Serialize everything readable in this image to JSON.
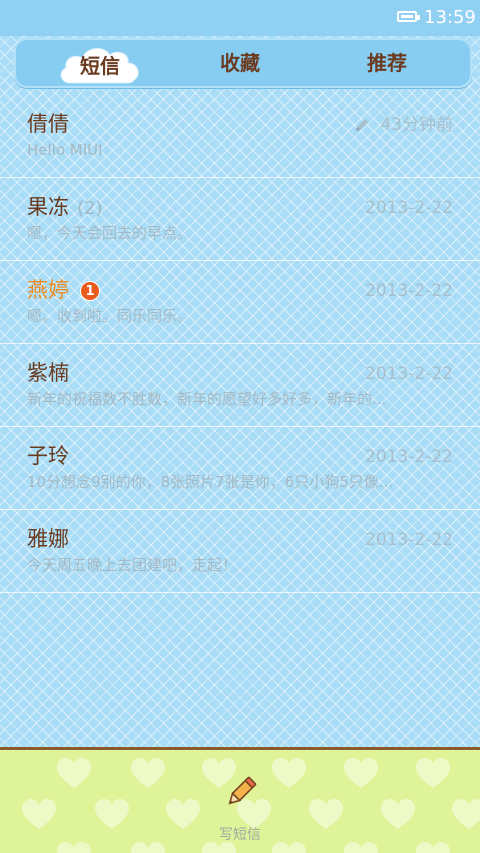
{
  "status_bar": {
    "time": "13:59",
    "battery_icon": "battery-full-icon"
  },
  "tabs": [
    {
      "label": "短信",
      "active": true
    },
    {
      "label": "收藏",
      "active": false
    },
    {
      "label": "推荐",
      "active": false
    }
  ],
  "conversations": [
    {
      "name": "倩倩",
      "count": "",
      "unread": "",
      "preview": "Hello MIUI",
      "time": "43分钟前",
      "draft": true
    },
    {
      "name": "果冻",
      "count": "(2)",
      "unread": "",
      "preview": "嗯，今天会回去的早点。",
      "time": "2013-2-22",
      "draft": false
    },
    {
      "name": "燕婷",
      "count": "",
      "unread": "1",
      "preview": "嗯。收到啦。同乐同乐。",
      "time": "2013-2-22",
      "draft": false
    },
    {
      "name": "紫楠",
      "count": "",
      "unread": "",
      "preview": "新年的祝福数不胜数，新年的愿望好多好多，新年的...",
      "time": "2013-2-22",
      "draft": false
    },
    {
      "name": "子玲",
      "count": "",
      "unread": "",
      "preview": "10分想念9别的你，8张照片7张是你，6只小狗5只像...",
      "time": "2013-2-22",
      "draft": false
    },
    {
      "name": "雅娜",
      "count": "",
      "unread": "",
      "preview": "今天周五晚上去团建吧，走起！",
      "time": "2013-2-22",
      "draft": false
    }
  ],
  "bottom_bar": {
    "compose_label": "写短信",
    "compose_icon": "pencil-icon"
  },
  "colors": {
    "accent_brown": "#6a3b1f",
    "unread_orange": "#ef8a1f",
    "badge_red": "#ea5a1d",
    "list_bg": "#a9dcf6",
    "bottom_bg": "#dff499"
  }
}
